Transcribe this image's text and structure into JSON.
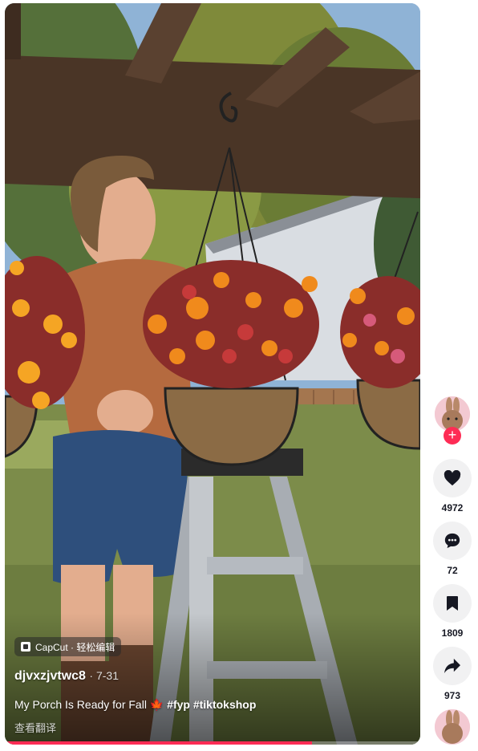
{
  "video": {
    "watermark": "CapCut · 轻松编辑",
    "author": "djvxzjvtwc8",
    "date": "7-31",
    "caption_text": "My Porch Is Ready for Fall",
    "caption_emoji": "🍁",
    "caption_tags": "#fyp #tiktokshop",
    "translate_label": "查看翻译",
    "progress": 0.74
  },
  "actions": {
    "follow_label": "+",
    "likes": "4972",
    "comments": "72",
    "saves": "1809",
    "shares": "973"
  },
  "colors": {
    "accent": "#fe2c55",
    "rail_button_bg": "#f1f1f2"
  }
}
